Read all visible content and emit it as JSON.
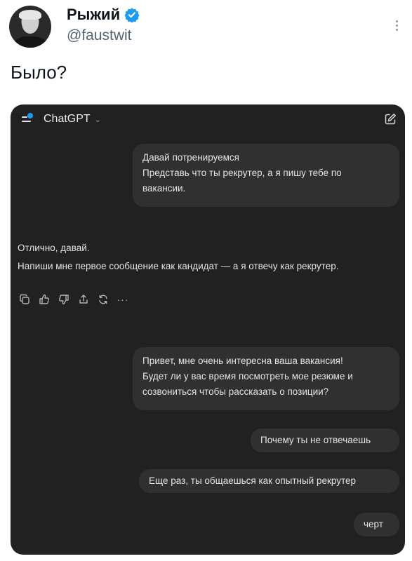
{
  "tweet": {
    "author_name": "Рыжий",
    "handle": "@faustwit",
    "text": "Было?",
    "icons": {
      "verified": "verified-badge-icon",
      "more": "more-vertical-icon"
    },
    "colors": {
      "verified": "#1d9bf0",
      "text": "#0f1419",
      "secondary": "#536471"
    }
  },
  "chat": {
    "model_label": "ChatGPT",
    "colors": {
      "background": "#212121",
      "bubble": "#303030",
      "text": "#e3e3e3",
      "accent_dot": "#1d9bf0"
    },
    "icons": [
      "menu-icon",
      "chevron-down-icon",
      "new-chat-icon"
    ],
    "messages": [
      {
        "role": "user",
        "lines": [
          "Давай потренируемся",
          "Представь что ты рекрутер, а я пишу тебе по",
          "вакансии."
        ]
      },
      {
        "role": "assistant",
        "lines": [
          "Отлично, давай.",
          "Напиши мне первое сообщение как кандидат — а я отвечу как рекрутер."
        ]
      },
      {
        "role": "user",
        "lines": [
          "Привет, мне очень интересна ваша вакансия!",
          "Будет ли у вас время посмотреть мое резюме и",
          "созвониться чтобы рассказать о позиции?"
        ]
      },
      {
        "role": "user",
        "lines": [
          "Почему ты не отвечаешь"
        ]
      },
      {
        "role": "user",
        "lines": [
          "Еще раз, ты общаешься как опытный рекрутер"
        ]
      },
      {
        "role": "user",
        "lines": [
          "черт"
        ]
      }
    ],
    "message_actions": [
      "copy-icon",
      "thumbs-up-icon",
      "thumbs-down-icon",
      "share-icon",
      "regenerate-icon",
      "more-horizontal-icon"
    ],
    "more_label": "···"
  }
}
